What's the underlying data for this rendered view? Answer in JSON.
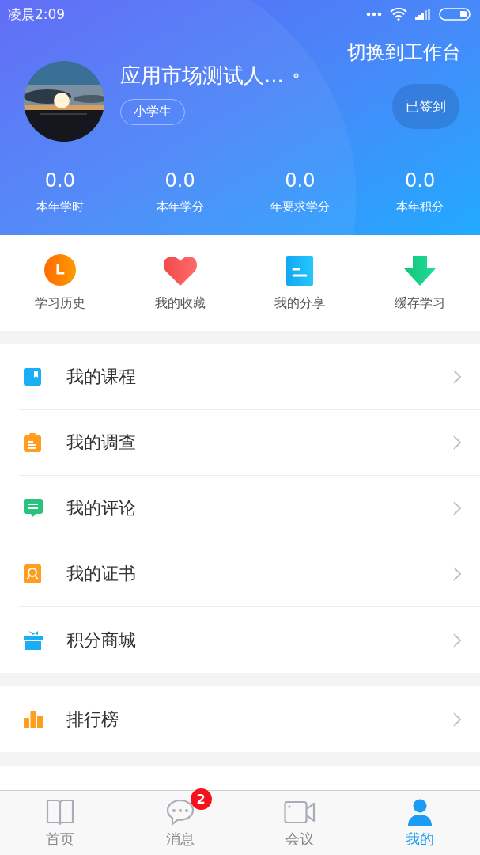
{
  "status_bar": {
    "time": "凌晨2:09"
  },
  "profile": {
    "name": "应用市场测试人...",
    "tag": "小学生",
    "switch_label": "切换到工作台",
    "checkin_label": "已签到"
  },
  "stats": [
    {
      "value": "0.0",
      "label": "本年学时"
    },
    {
      "value": "0.0",
      "label": "本年学分"
    },
    {
      "value": "0.0",
      "label": "年要求学分"
    },
    {
      "value": "0.0",
      "label": "本年积分"
    }
  ],
  "shortcuts": [
    {
      "label": "学习历史",
      "kind": "clock"
    },
    {
      "label": "我的收藏",
      "kind": "heart"
    },
    {
      "label": "我的分享",
      "kind": "document"
    },
    {
      "label": "缓存学习",
      "kind": "download"
    }
  ],
  "menu_groups": [
    [
      {
        "label": "我的课程",
        "kind": "book"
      },
      {
        "label": "我的调查",
        "kind": "clipboard"
      },
      {
        "label": "我的评论",
        "kind": "comment"
      },
      {
        "label": "我的证书",
        "kind": "certificate"
      },
      {
        "label": "积分商城",
        "kind": "gift"
      }
    ],
    [
      {
        "label": "排行榜",
        "kind": "chart"
      }
    ]
  ],
  "tabs": [
    {
      "label": "首页",
      "kind": "home",
      "selected": false
    },
    {
      "label": "消息",
      "kind": "message",
      "selected": false,
      "badge": "2"
    },
    {
      "label": "会议",
      "kind": "video",
      "selected": false
    },
    {
      "label": "我的",
      "kind": "profile",
      "selected": true
    }
  ]
}
